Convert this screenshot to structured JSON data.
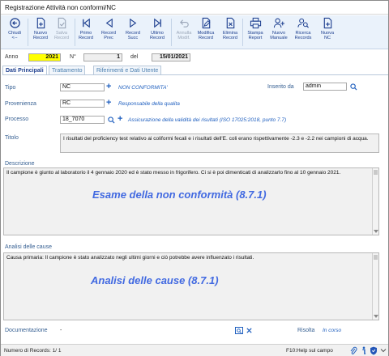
{
  "window": {
    "title": "Registrazione Attività non conformi/NC"
  },
  "toolbar": {
    "buttons": [
      {
        "name": "chiudi",
        "label": "Chiudi\n<--",
        "disabled": false
      },
      {
        "name": "nuovo-record",
        "label": "Nuovo\nRecord",
        "disabled": false
      },
      {
        "name": "salva-record",
        "label": "Salva\nRecord",
        "disabled": true
      },
      {
        "name": "primo-record",
        "label": "Primo\nRecord",
        "disabled": false
      },
      {
        "name": "record-prec",
        "label": "Record\nPrec",
        "disabled": false
      },
      {
        "name": "record-succ",
        "label": "Record\nSucc",
        "disabled": false
      },
      {
        "name": "ultimo-record",
        "label": "Ultimo\nRecord",
        "disabled": false
      },
      {
        "name": "annulla-modif",
        "label": "Annulla\nModif.",
        "disabled": true
      },
      {
        "name": "modifica-record",
        "label": "Modifica\nRecord",
        "disabled": false
      },
      {
        "name": "elimina-record",
        "label": "Elimina\nRecord",
        "disabled": false
      },
      {
        "name": "stampa-report",
        "label": "Stampa\nReport",
        "disabled": false
      },
      {
        "name": "nuovo-manuale",
        "label": "Nuovo\nManuale",
        "disabled": false
      },
      {
        "name": "ricerca-records",
        "label": "Ricerca\nRecords",
        "disabled": false
      },
      {
        "name": "nuova-nc",
        "label": "Nuova\nNC",
        "disabled": false
      }
    ]
  },
  "header": {
    "anno_label": "Anno",
    "anno_value": "2021",
    "numero_label": "N°",
    "numero_value": "1",
    "del_label": "del",
    "date_value": "15/01/2021"
  },
  "tabs": [
    "Dati Principali",
    "Trattamento",
    "Riferimenti e Dati Utente"
  ],
  "form": {
    "tipo_label": "Tipo",
    "tipo_value": "NC",
    "tipo_link": "NON CONFORMITA'",
    "inserito_label": "Inserito da",
    "inserito_value": "admin",
    "provenienza_label": "Provenienza",
    "provenienza_value": "RC",
    "provenienza_link": "Responsabile della qualita",
    "processo_label": "Processo",
    "processo_value": "18_7070",
    "processo_link": "Assicurazione della validità dei risultati (ISO 17025:2018, punto 7.7)",
    "titolo_label": "Titolo",
    "titolo_value": "I risultati del proficiency test relativo ai coliformi fecali e i risultati dell'E. coli erano rispettivamente -2.3 e -2.2 nei campioni di acqua.",
    "descrizione_label": "Descrizione",
    "descrizione_value": "Il campione è giunto al laboratorio il 4 gennaio 2020 ed è stato messo in frigorifero. Ci si è poi dimenticati di analizzarlo fino al 10 gennaio 2021.",
    "descrizione_overlay": "Esame della non conformità (8.7.1)",
    "analisi_label": "Analisi delle cause",
    "analisi_value": "Causa primaria: Il campione è stato analizzato negli ultimi giorni e ciò potrebbe avere influenzato i risultati.",
    "analisi_overlay": "Analisi delle cause (8.7.1)",
    "documentazione_label": "Documentazione",
    "documentazione_value": "-",
    "risolta_label": "Risolta",
    "risolta_value": "In corso"
  },
  "status": {
    "records": "Numero di Records: 1/ 1",
    "help": "F10:Help sul campo"
  }
}
